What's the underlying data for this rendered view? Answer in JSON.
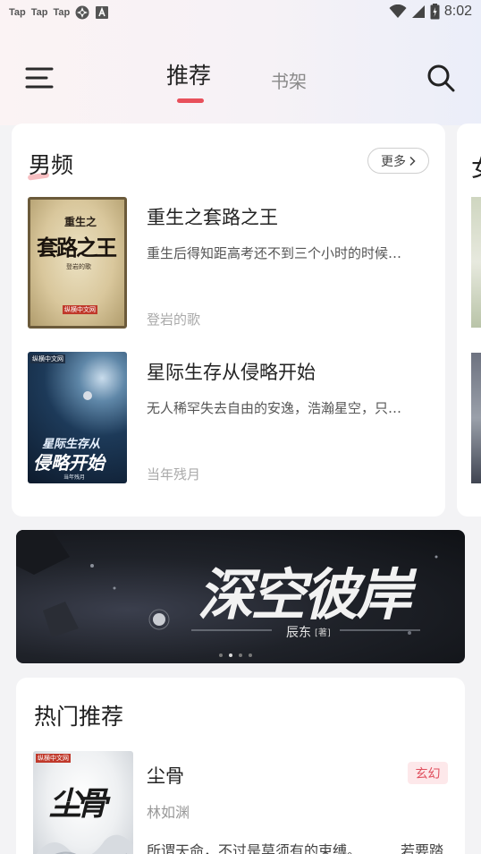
{
  "status_bar": {
    "left_apps": [
      "Tap",
      "Tap",
      "Tap"
    ],
    "time": "8:02"
  },
  "header": {
    "tabs": [
      {
        "label": "推荐",
        "active": true
      },
      {
        "label": "书架",
        "active": false
      }
    ]
  },
  "male_section": {
    "title": "男频",
    "more_label": "更多",
    "books": [
      {
        "title": "重生之套路之王",
        "desc": "重生后得知距高考还不到三个小时的时候…",
        "author": "登岩的歌",
        "cover_text": "套路之王",
        "cover_small": "重生之",
        "cover_author": "登岩的歌",
        "cover_publisher": "纵横中文网"
      },
      {
        "title": "星际生存从侵略开始",
        "desc": "无人稀罕失去自由的安逸，浩瀚星空，只…",
        "author": "当年残月",
        "cover_text_line1": "星际生存从",
        "cover_text_line2": "侵略开始",
        "cover_author": "当年残月",
        "cover_publisher": "纵横中文网"
      }
    ]
  },
  "peek_section": {
    "title": "女"
  },
  "banner": {
    "title": "深空彼岸",
    "author": "辰东",
    "author_tag": "[著]",
    "slide_count": 4,
    "active_slide": 1
  },
  "hot_section": {
    "title": "热门推荐",
    "book": {
      "title": "尘骨",
      "author": "林如渊",
      "genre": "玄幻",
      "desc": "所谓天命，不过是莫须有的束缚。",
      "desc_tail": "若要踏",
      "cover_text": "尘骨",
      "cover_publisher": "纵横中文网"
    }
  },
  "colors": {
    "accent": "#e8505b",
    "badge_bg": "#fde8ea",
    "badge_text": "#e04e5c"
  }
}
